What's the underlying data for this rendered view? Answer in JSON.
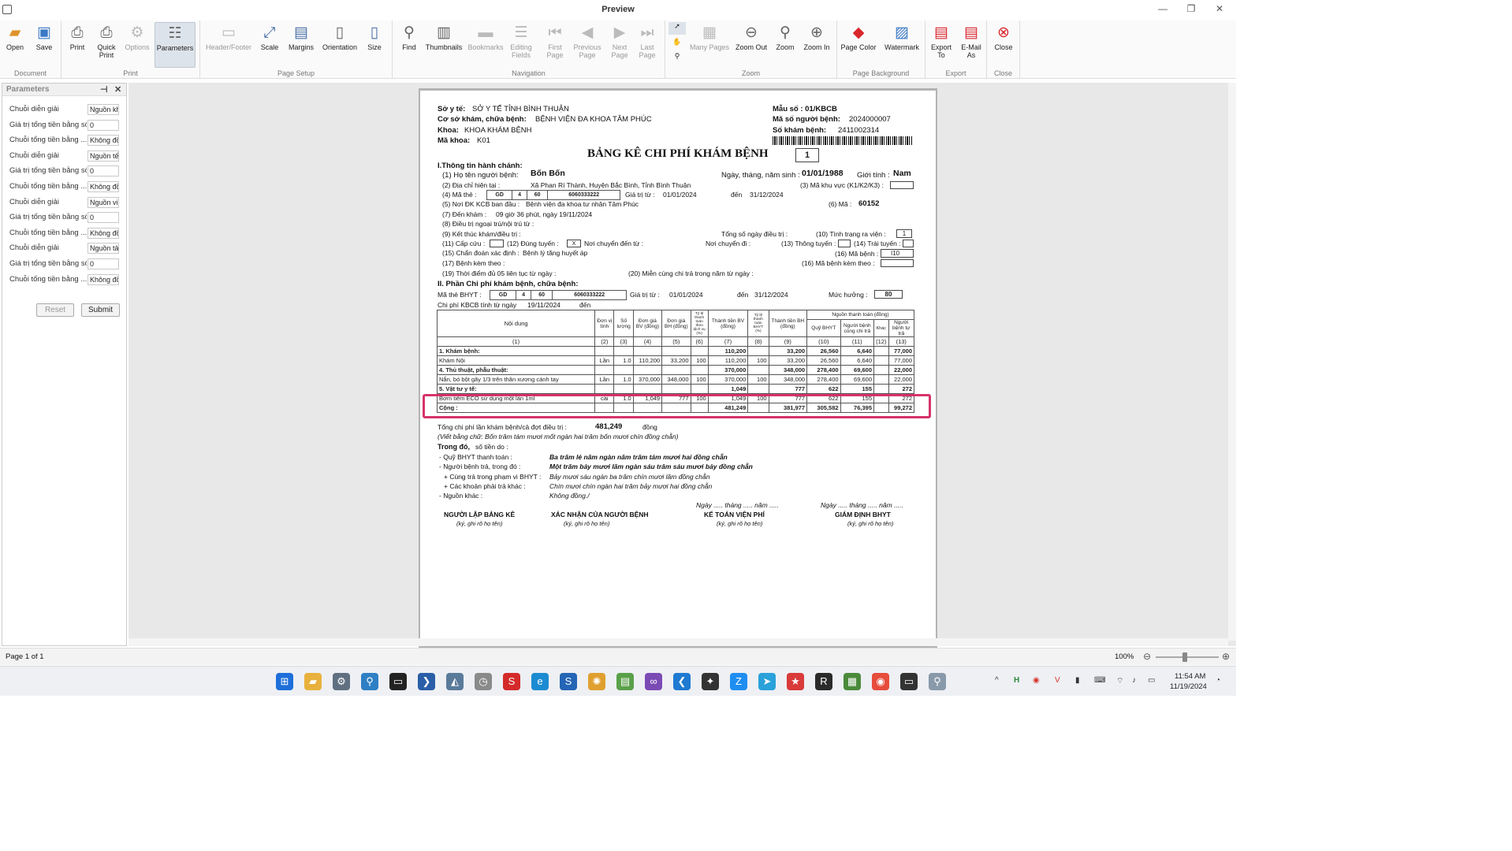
{
  "window": {
    "title": "Preview"
  },
  "ribbon": {
    "groups": {
      "document": "Document",
      "print": "Print",
      "page_setup": "Page Setup",
      "navigation": "Navigation",
      "zoom": "Zoom",
      "page_background": "Page Background",
      "export": "Export",
      "close": "Close"
    },
    "buttons": {
      "open": "Open",
      "save": "Save",
      "print": "Print",
      "quick_print": "Quick Print",
      "options": "Options",
      "parameters": "Parameters",
      "header_footer": "Header/Footer",
      "scale": "Scale",
      "margins": "Margins",
      "orientation": "Orientation",
      "size": "Size",
      "find": "Find",
      "thumbnails": "Thumbnails",
      "bookmarks": "Bookmarks",
      "editing_fields": "Editing Fields",
      "first_page": "First Page",
      "previous_page": "Previous Page",
      "next_page": "Next Page",
      "last_page": "Last Page",
      "many_pages": "Many Pages",
      "zoom_out": "Zoom Out",
      "zoom": "Zoom",
      "zoom_in": "Zoom In",
      "page_color": "Page Color",
      "watermark": "Watermark",
      "export_to": "Export To",
      "email_as": "E-Mail As",
      "close": "Close"
    }
  },
  "parameters": {
    "title": "Parameters",
    "rows": [
      {
        "label": "Chuỗi diễn giải",
        "value": "Nguồn kh"
      },
      {
        "label": "Giá trị tổng tiền bằng số",
        "value": "0"
      },
      {
        "label": "Chuỗi tổng tiền bằng ...",
        "value": "Không đồ"
      },
      {
        "label": "Chuỗi diễn giải",
        "value": "Nguồn tế"
      },
      {
        "label": "Giá trị tổng tiền bằng số",
        "value": "0"
      },
      {
        "label": "Chuỗi tổng tiền bằng ...",
        "value": "Không đồ"
      },
      {
        "label": "Chuỗi diễn giải",
        "value": "Nguồn vi"
      },
      {
        "label": "Giá trị tổng tiền bằng số",
        "value": "0"
      },
      {
        "label": "Chuỗi tổng tiền bằng ...",
        "value": "Không đồ"
      },
      {
        "label": "Chuỗi diễn giải",
        "value": "Nguồn tả"
      },
      {
        "label": "Giá trị tổng tiền bằng số",
        "value": "0"
      },
      {
        "label": "Chuỗi tổng tiền bằng ...",
        "value": "Không đồ"
      }
    ],
    "reset": "Reset",
    "submit": "Submit"
  },
  "document": {
    "so_y_te_label": "Sở y tế:",
    "so_y_te": "SỞ Y TẾ TỈNH BÌNH THUẬN",
    "co_so_label": "Cơ sở khám, chữa bệnh:",
    "co_so": "BỆNH VIỆN ĐA KHOA TÂM PHÚC",
    "khoa_label": "Khoa:",
    "khoa": "KHOA KHÁM BỆNH",
    "ma_khoa_label": "Mã khoa:",
    "ma_khoa": "K01",
    "mau_so": "Mẫu số : 01/KBCB",
    "ma_so_nb_label": "Mã số người bệnh:",
    "ma_so_nb": "2024000007",
    "so_kham_label": "Số khám bệnh:",
    "so_kham": "2411002314",
    "title": "BẢNG KÊ CHI PHÍ KHÁM BỆNH",
    "title_no": "1",
    "s1": "I.Thông tin hành chánh:",
    "l1": "(1) Họ tên người bệnh:",
    "ho_ten": "Bốn Bốn",
    "ngay_sinh_label": "Ngày, tháng, năm sinh :",
    "ngay_sinh": "01/01/1988",
    "gioi_tinh_label": "Giới tính :",
    "gioi_tinh": "Nam",
    "l2": "(2) Địa chỉ hiện tại :",
    "dia_chi": "Xã Phan Rí Thành, Huyện Bắc Bình, Tỉnh Bình Thuận",
    "l3": "(3) Mã khu vực (K1/K2/K3) :",
    "l4": "(4) Mã thẻ :",
    "the_parts": [
      "GD",
      "4",
      "60",
      "6060333222"
    ],
    "gia_tri_tu_label": "Giá trị từ :",
    "gia_tri_tu": "01/01/2024",
    "den_label": "đến",
    "den": "31/12/2024",
    "l5": "(5) Nơi ĐK KCB ban đầu :",
    "noi_dk": "Bệnh viện đa khoa tư nhân Tâm Phúc",
    "l6": "(6) Mã :",
    "ma6": "60152",
    "l7": "(7) Đến khám :",
    "den_kham": "09 giờ 36 phút, ngày 19/11/2024",
    "l8": "(8) Điều trị ngoại trú/nội trú từ :",
    "l9": "(9) Kết thúc khám/điều trị :",
    "tong_so_ngay": "Tổng số ngày điều trị :",
    "l10": "(10) Tình trạng ra viện :",
    "tinh_trang": "1",
    "l11": "(11) Cấp cứu :",
    "l12": "(12) Đúng tuyến :",
    "dung_tuyen": "X",
    "noi_chuyen_den": "Nơi chuyển đến từ :",
    "noi_chuyen_di": "Nơi chuyển đi :",
    "l13": "(13) Thông tuyến :",
    "l14": "(14) Trái tuyến :",
    "l15": "(15) Chẩn đoán xác định :",
    "chan_doan": "Bệnh lý tăng huyết áp",
    "l16": "(16) Mã bệnh :",
    "ma_benh": "I10",
    "l17": "(17) Bệnh kèm theo :",
    "l16b": "(16) Mã bệnh kèm theo :",
    "l19": "(19) Thời điểm đủ 05 liên tục từ ngày :",
    "l20": "(20) Miễn cùng chi trả trong năm từ ngày :",
    "s2": "II. Phần Chi phí khám bệnh, chữa bệnh:",
    "ma_the_bhyt": "Mã thẻ BHYT :",
    "muc_huong_label": "Mức hưởng :",
    "muc_huong": "80",
    "chi_phi_tu_label": "Chi phí KBCB tính từ ngày",
    "chi_phi_tu": "19/11/2024",
    "chi_phi_den": "đến",
    "table": {
      "nguon_tt": "Nguồn thanh toán (đồng)",
      "headers": [
        "Nội dung",
        "Đơn vị tính",
        "Số lượng",
        "Đơn giá BV (đồng)",
        "Đơn giá BH (đồng)",
        "Tỷ lệ thanh toán theo dịch vụ (%)",
        "Thành tiền BV (đồng)",
        "Tỷ lệ thanh toán BHYT (%)",
        "Thành tiền BH (đồng)",
        "Quỹ BHYT",
        "Người bệnh cùng chi trả",
        "Khác",
        "Người bệnh tự trả"
      ],
      "nums": [
        "(1)",
        "(2)",
        "(3)",
        "(4)",
        "(5)",
        "(6)",
        "(7)",
        "(8)",
        "(9)",
        "(10)",
        "(11)",
        "(12)",
        "(13)"
      ],
      "rows": [
        {
          "c": [
            "1. Khám bệnh:",
            "",
            "",
            "",
            "",
            "",
            "110,200",
            "",
            "33,200",
            "26,560",
            "6,640",
            "",
            "77,000"
          ],
          "bold": true
        },
        {
          "c": [
            "  Khám Nội",
            "Lần",
            "1.0",
            "110,200",
            "33,200",
            "100",
            "110,200",
            "100",
            "33,200",
            "26,560",
            "6,640",
            "",
            "77,000"
          ],
          "bold": false
        },
        {
          "c": [
            "4. Thủ thuật, phẫu thuật:",
            "",
            "",
            "",
            "",
            "",
            "370,000",
            "",
            "348,000",
            "278,400",
            "69,600",
            "",
            "22,000"
          ],
          "bold": true
        },
        {
          "c": [
            "  Nắn, bó bột gãy 1/3 trên thân xương cánh tay",
            "Lần",
            "1.0",
            "370,000",
            "348,000",
            "100",
            "370,000",
            "100",
            "348,000",
            "278,400",
            "69,600",
            "",
            "22,000"
          ],
          "bold": false
        },
        {
          "c": [
            "5. Vật tư y tế:",
            "",
            "",
            "",
            "",
            "",
            "1,049",
            "",
            "777",
            "622",
            "155",
            "",
            "272"
          ],
          "bold": true
        },
        {
          "c": [
            "  Bơm tiêm ECO sử dụng một lần 1ml",
            "cái",
            "1.0",
            "1,049",
            "777",
            "100",
            "1,049",
            "100",
            "777",
            "622",
            "155",
            "",
            "272"
          ],
          "bold": false
        },
        {
          "c": [
            "Cộng :",
            "",
            "",
            "",
            "",
            "",
            "481,249",
            "",
            "381,977",
            "305,582",
            "76,395",
            "",
            "99,272"
          ],
          "bold": true
        }
      ]
    },
    "tong_label": "Tổng chi phí lần khám bệnh/cả đợt điều trị :",
    "tong": "481,249",
    "tong_unit": "đồng",
    "viet_bang_chu": "(Viết bằng chữ: Bốn trăm tám mươi mốt ngàn hai trăm bốn mươi chín đồng chẵn)",
    "trong_do": "Trong đó,",
    "so_tien_do": "số tiền do :",
    "quy_label": "- Quỹ BHYT thanh toán :",
    "quy": "Ba trăm lẻ năm ngàn năm trăm tám mươi hai đồng chẵn",
    "nb_label": "- Người bệnh trả, trong đó :",
    "nb": "Một trăm bảy mươi lăm ngàn sáu trăm sáu mươi bảy đồng chẵn",
    "ct_label": "+ Cùng trả trong phạm vi BHYT :",
    "ct": "Bảy mươi sáu ngàn ba trăm chín mươi lăm đồng chẵn",
    "ck_label": "+ Các khoản phải trả khác :",
    "ck": "Chín mươi chín ngàn hai trăm bảy mươi hai đồng chẵn",
    "nk_label": "- Nguồn khác :",
    "nk": "Không đồng./",
    "date_line": "Ngày ..... tháng ..... năm .....",
    "sign": [
      {
        "title": "NGƯỜI LẬP BẢNG KÊ",
        "note": "(ký, ghi rõ họ tên)"
      },
      {
        "title": "XÁC NHẬN CỦA NGƯỜI BỆNH",
        "note": "(ký, ghi rõ họ tên)"
      },
      {
        "title": "KẾ TOÁN VIỆN PHÍ",
        "note": "(ký, ghi rõ họ tên)"
      },
      {
        "title": "GIÁM ĐỊNH BHYT",
        "note": "(ký, ghi rõ họ tên)"
      }
    ]
  },
  "status": {
    "page": "Page 1 of 1",
    "zoom": "100%"
  },
  "taskbar": {
    "time": "11:54 AM",
    "date": "11/19/2024"
  }
}
